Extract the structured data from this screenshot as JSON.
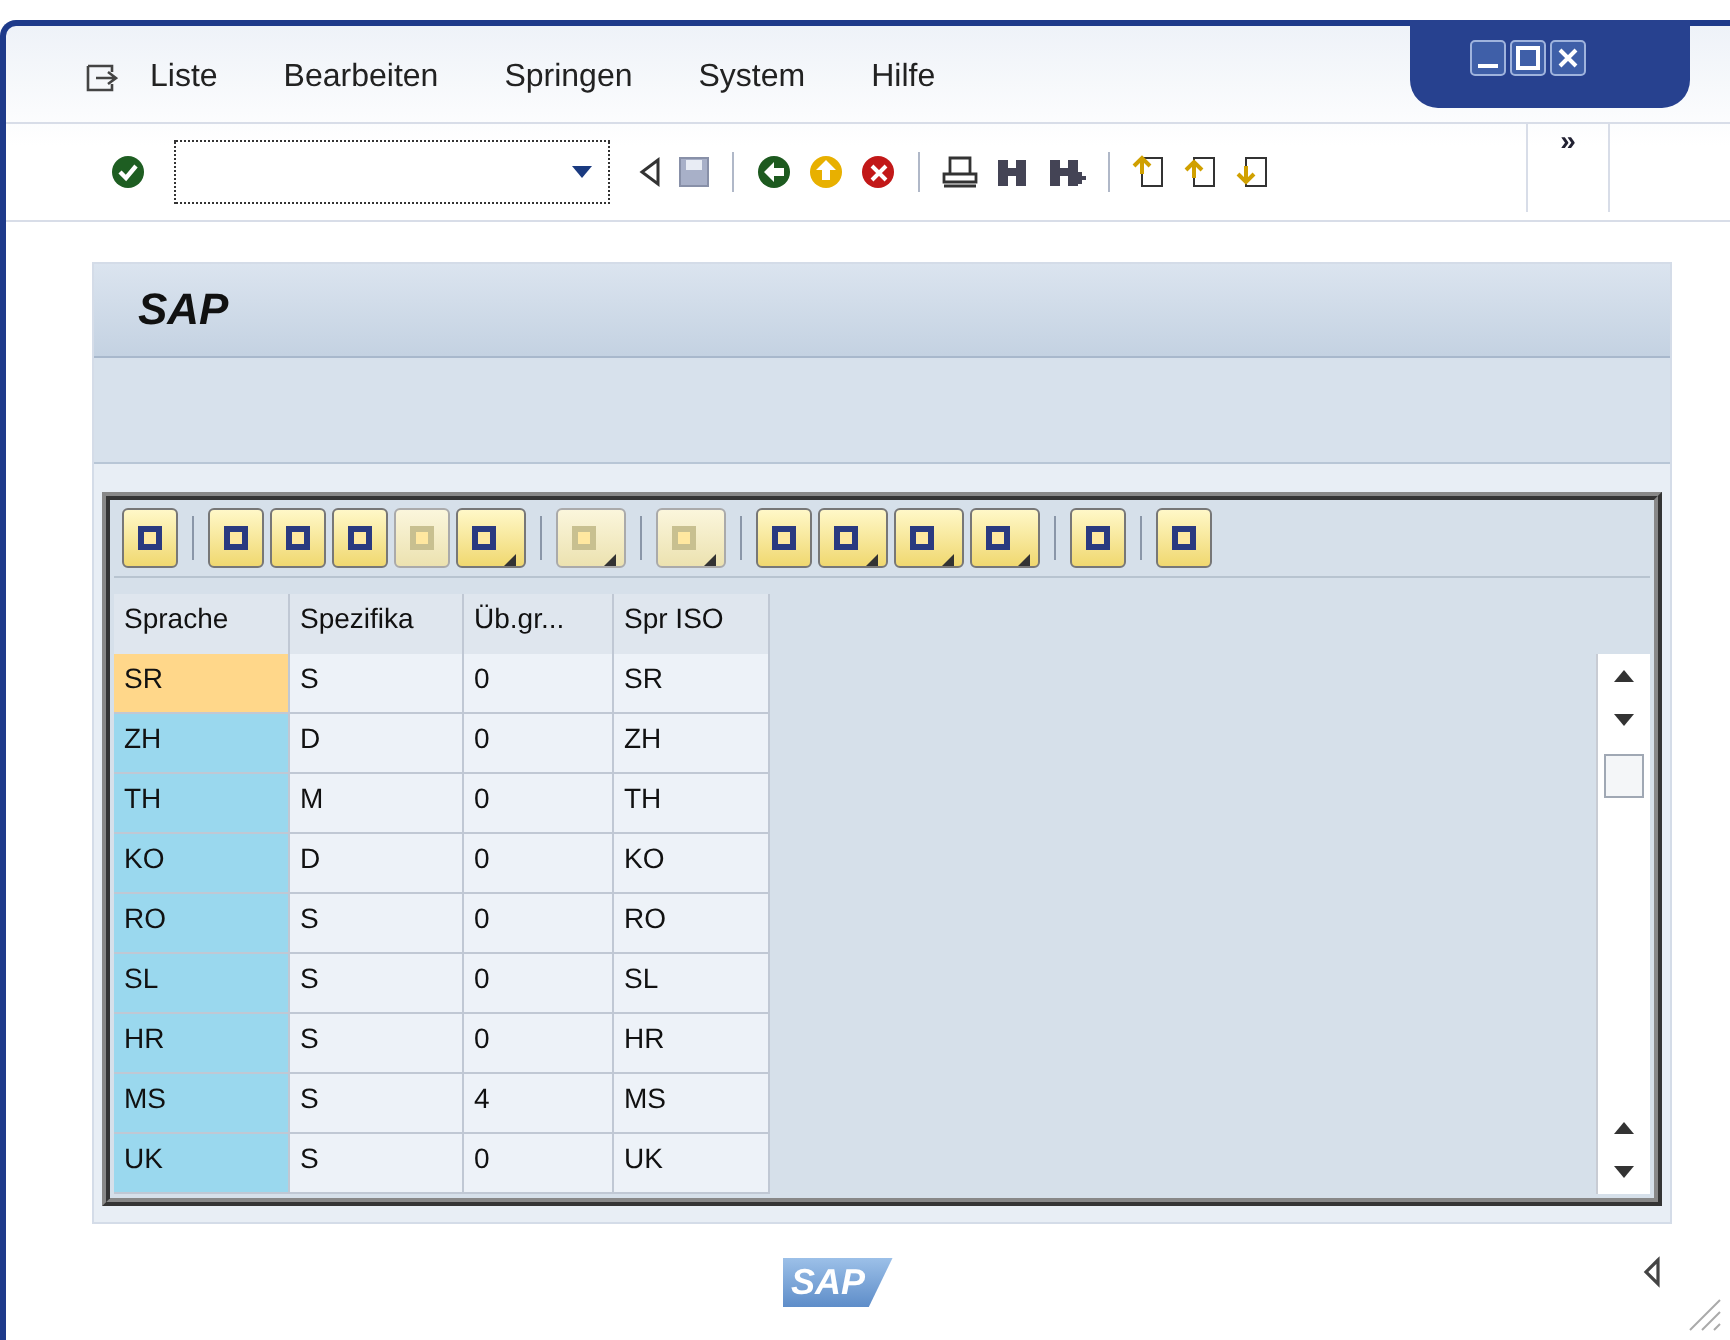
{
  "menu": [
    {
      "label": "Liste"
    },
    {
      "label": "Bearbeiten"
    },
    {
      "label": "Springen"
    },
    {
      "label": "System"
    },
    {
      "label": "Hilfe"
    }
  ],
  "toolbar": {
    "overflow": "»"
  },
  "title": "SAP",
  "grid": {
    "columns": [
      "Sprache",
      "Spezifika",
      "Üb.gr...",
      "Spr ISO"
    ],
    "rows": [
      {
        "cells": [
          "SR",
          "S",
          "0",
          "SR"
        ],
        "selected": true
      },
      {
        "cells": [
          "ZH",
          "D",
          "0",
          "ZH"
        ],
        "selected": false
      },
      {
        "cells": [
          "TH",
          "M",
          "0",
          "TH"
        ],
        "selected": false
      },
      {
        "cells": [
          "KO",
          "D",
          "0",
          "KO"
        ],
        "selected": false
      },
      {
        "cells": [
          "RO",
          "S",
          "0",
          "RO"
        ],
        "selected": false
      },
      {
        "cells": [
          "SL",
          "S",
          "0",
          "SL"
        ],
        "selected": false
      },
      {
        "cells": [
          "HR",
          "S",
          "0",
          "HR"
        ],
        "selected": false
      },
      {
        "cells": [
          "MS",
          "S",
          "4",
          "MS"
        ],
        "selected": false
      },
      {
        "cells": [
          "UK",
          "S",
          "0",
          "UK"
        ],
        "selected": false
      }
    ]
  },
  "footer": {
    "logo": "SAP"
  }
}
